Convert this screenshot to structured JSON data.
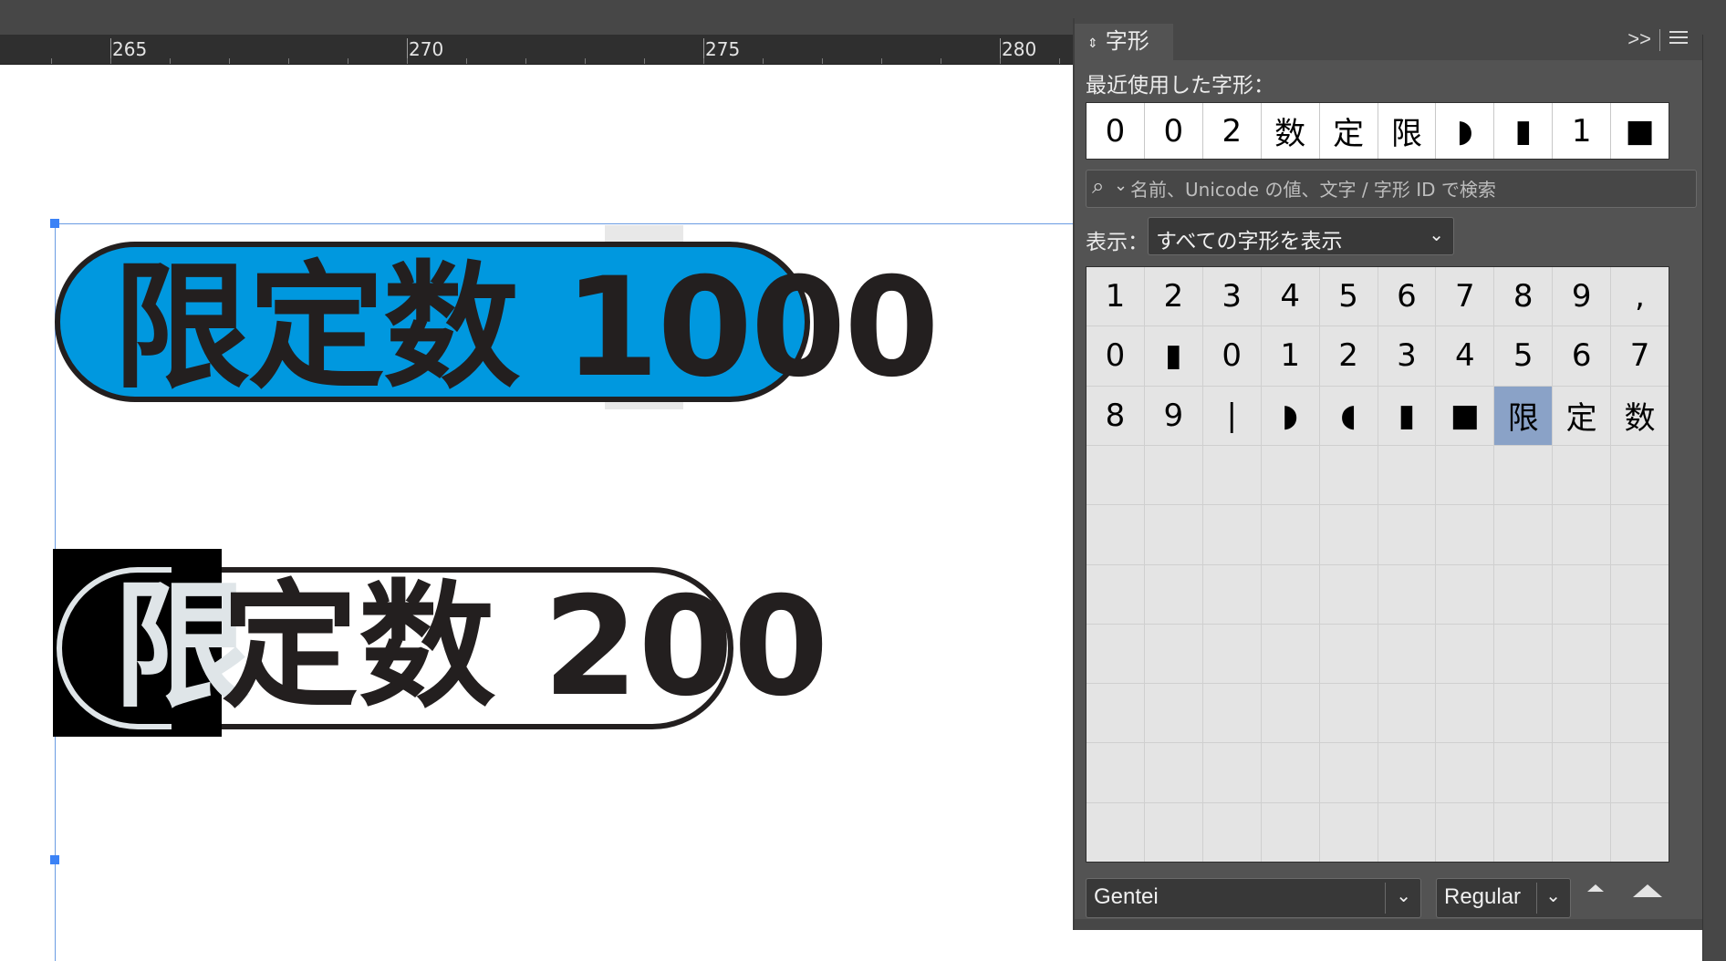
{
  "ruler": {
    "labels": [
      "265",
      "270",
      "275",
      "280"
    ]
  },
  "artwork": {
    "badge1_text": "限定数 1000",
    "badge2_char1": "限",
    "badge2_rest": "定数 200",
    "colors": {
      "badge1_fill": "#0098df",
      "stroke": "#231f1f",
      "inverse": "#000000"
    }
  },
  "panel": {
    "tab_title": "字形",
    "expand_icon": ">>",
    "recent_label": "最近使用した字形：",
    "recent": [
      "0",
      "0",
      "2",
      "数",
      "定",
      "限",
      "◗",
      "▮",
      "1",
      "■"
    ],
    "search_placeholder": "名前、Unicode の値、文字 / 字形 ID で検索",
    "show_label": "表示：",
    "show_value": "すべての字形を表示",
    "glyph_rows": [
      [
        "1",
        "2",
        "3",
        "4",
        "5",
        "6",
        "7",
        "8",
        "9",
        ","
      ],
      [
        "0",
        "▮",
        "0",
        "1",
        "2",
        "3",
        "4",
        "5",
        "6",
        "7"
      ],
      [
        "8",
        "9",
        "|",
        "◗",
        "◖",
        "▮",
        "■",
        "限",
        "定",
        "数"
      ]
    ],
    "font_family": "Gentei",
    "font_style": "Regular"
  }
}
